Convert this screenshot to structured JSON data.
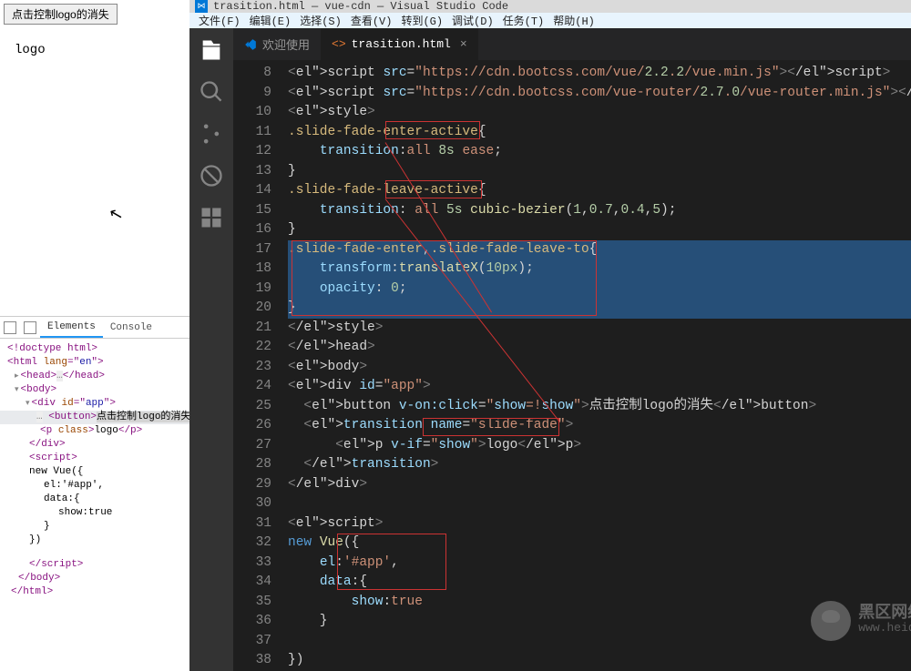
{
  "browser": {
    "button_label": "点击控制logo的消失",
    "logo_text": "logo"
  },
  "devtools": {
    "tab_elements": "Elements",
    "tab_console": "Console",
    "tree": {
      "doctype": "<!doctype html>",
      "html_open": "<html lang=\"en\">",
      "head": "<head>…</head>",
      "body_open": "<body>",
      "div_open": "<div id=\"app\">",
      "button": "<button>点击控制logo的消失",
      "p": "<p class>logo</p>",
      "div_close": "</div>",
      "script1": "<script>",
      "vue_new": "new Vue({",
      "vue_el": "el:'#app',",
      "vue_data": "data:{",
      "vue_show": "show:true",
      "brace1": "}",
      "brace2": "})",
      "script_close": "</script>",
      "body_close": "</body>",
      "html_close": "</html>"
    }
  },
  "vscode": {
    "title": "trasition.html — vue-cdn — Visual Studio Code",
    "menu": {
      "file": "文件(F)",
      "edit": "编辑(E)",
      "select": "选择(S)",
      "view": "查看(V)",
      "goto": "转到(G)",
      "debug": "调试(D)",
      "tasks": "任务(T)",
      "help": "帮助(H)"
    },
    "tabs": {
      "welcome": "欢迎使用",
      "file": "trasition.html"
    },
    "line_start": 8,
    "lines": [
      "<script src=\"https://cdn.bootcss.com/vue/2.2.2/vue.min.js\"></script>",
      "<script src=\"https://cdn.bootcss.com/vue-router/2.7.0/vue-router.min.js\"></sc",
      "<style>",
      ".slide-fade-enter-active{",
      "    transition:all 8s ease;",
      "}",
      ".slide-fade-leave-active{",
      "    transition: all 5s cubic-bezier(1,0.7,0.4,5);",
      "}",
      ".slide-fade-enter,.slide-fade-leave-to{",
      "    transform:translateX(10px);",
      "    opacity: 0;",
      "}",
      "</style>",
      "</head>",
      "<body>",
      "<div id=\"app\">",
      "  <button v-on:click=\"show=!show\">点击控制logo的消失</button>",
      "  <transition name=\"slide-fade\">",
      "      <p v-if=\"show\">logo</p>",
      "  </transition>",
      "</div>",
      "",
      "<script>",
      "new Vue({",
      "    el:'#app',",
      "    data:{",
      "        show:true",
      "    }",
      "",
      "})"
    ]
  },
  "watermark": {
    "cn": "黑区网络",
    "url": "www.heiqu.com"
  }
}
